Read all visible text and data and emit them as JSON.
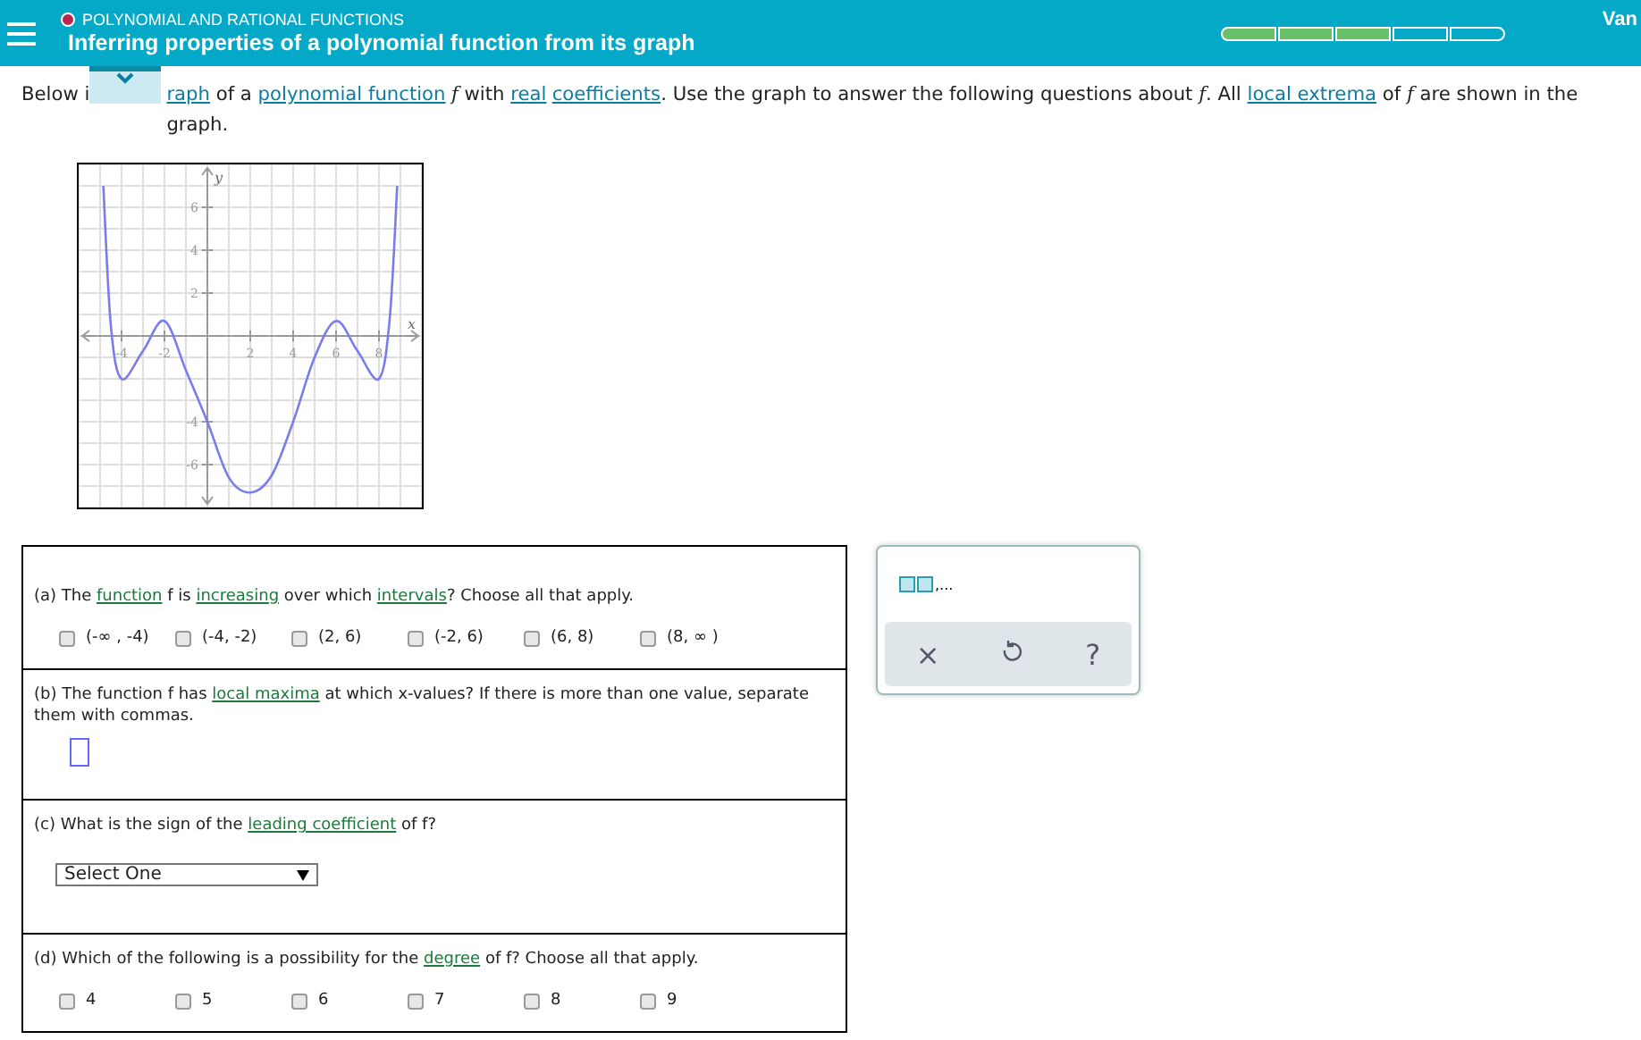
{
  "header": {
    "category": "POLYNOMIAL AND RATIONAL FUNCTIONS",
    "title": "Inferring properties of a polynomial function from its graph",
    "progress": [
      {
        "filled": true
      },
      {
        "filled": true
      },
      {
        "filled": true
      },
      {
        "filled": false
      },
      {
        "filled": false
      }
    ],
    "user": "Van"
  },
  "intro": {
    "before_tab": [
      {
        "kind": "text",
        "text": "Below i"
      }
    ],
    "after_tab": [
      {
        "kind": "link",
        "text": "raph"
      },
      {
        "kind": "text",
        "text": " of a "
      },
      {
        "kind": "link",
        "text": "polynomial function"
      },
      {
        "kind": "math",
        "text": "f"
      },
      {
        "kind": "text",
        "text": " with "
      },
      {
        "kind": "link",
        "text": "real"
      },
      {
        "kind": "link",
        "text": "coefficients"
      },
      {
        "kind": "text",
        "text": ". Use the graph to answer the following questions about "
      },
      {
        "kind": "math",
        "text": "f"
      },
      {
        "kind": "text",
        "text": ". All "
      },
      {
        "kind": "link",
        "text": "local extrema"
      },
      {
        "kind": "text",
        "text": " of "
      },
      {
        "kind": "math",
        "text": "f"
      },
      {
        "kind": "text",
        "text": " are shown in the graph."
      }
    ]
  },
  "graph": {
    "chart_data": {
      "type": "line",
      "grid": true,
      "xlabel": "x",
      "ylabel": "y",
      "xlim": [
        -6,
        10
      ],
      "ylim": [
        -8,
        8
      ],
      "xticks": [
        -4,
        -2,
        2,
        4,
        6,
        8
      ],
      "yticks": [
        -6,
        -4,
        2,
        4,
        6
      ],
      "x": [
        -4.85,
        -4.5,
        -4,
        -3,
        -2,
        -1,
        0,
        1,
        2,
        3,
        4,
        5,
        6,
        7,
        8,
        8.5,
        8.85
      ],
      "series": [
        {
          "color": "#7b7bf0",
          "values": [
            7,
            0.5,
            -2,
            -0.7,
            0.7,
            -1.6,
            -4,
            -6.6,
            -7.3,
            -6.5,
            -4,
            -1,
            0.7,
            -0.7,
            -2,
            0.8,
            7
          ]
        }
      ]
    }
  },
  "questions": [
    {
      "kind": "checkboxes",
      "text": [
        {
          "kind": "text",
          "text": "(a) The "
        },
        {
          "kind": "link",
          "text": "function"
        },
        {
          "kind": "text",
          "text": " f is "
        },
        {
          "kind": "link",
          "text": "increasing"
        },
        {
          "kind": "text",
          "text": " over which "
        },
        {
          "kind": "link",
          "text": "intervals"
        },
        {
          "kind": "text",
          "text": "? Choose all that apply."
        }
      ],
      "options": [
        {
          "label": "(-∞ , -4)",
          "checked": false
        },
        {
          "label": "(-4, -2)",
          "checked": false
        },
        {
          "label": "(2, 6)",
          "checked": false
        },
        {
          "label": "(-2, 6)",
          "checked": false
        },
        {
          "label": "(6, 8)",
          "checked": false
        },
        {
          "label": "(8, ∞ )",
          "checked": false
        }
      ]
    },
    {
      "kind": "input",
      "text": [
        {
          "kind": "text",
          "text": "(b) The function f has "
        },
        {
          "kind": "link",
          "text": "local maxima"
        },
        {
          "kind": "text",
          "text": " at which x-values? If there is more than one value, separate them with commas."
        }
      ]
    },
    {
      "kind": "select",
      "text": [
        {
          "kind": "text",
          "text": "(c) What is the sign of the "
        },
        {
          "kind": "link",
          "text": "leading coefficient"
        },
        {
          "kind": "text",
          "text": " of f?"
        }
      ],
      "value": "Select One"
    },
    {
      "kind": "checkboxes",
      "text": [
        {
          "kind": "text",
          "text": "(d) Which of the following is a possibility for the "
        },
        {
          "kind": "link",
          "text": "degree"
        },
        {
          "kind": "text",
          "text": " of f? Choose all that apply."
        }
      ],
      "options": [
        {
          "label": "4",
          "checked": false
        },
        {
          "label": "5",
          "checked": false
        },
        {
          "label": "6",
          "checked": false
        },
        {
          "label": "7",
          "checked": false
        },
        {
          "label": "8",
          "checked": false
        },
        {
          "label": "9",
          "checked": false
        }
      ]
    }
  ],
  "tools": {
    "template_suffix": ",...",
    "buttons": [
      {
        "kind": "clear",
        "symbol": "×"
      },
      {
        "kind": "undo"
      },
      {
        "kind": "help",
        "symbol": "?"
      }
    ]
  }
}
